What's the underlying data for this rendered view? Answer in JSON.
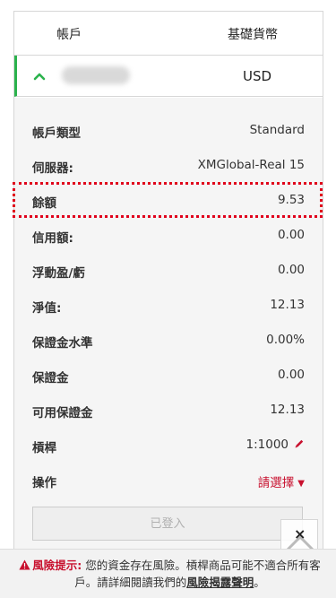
{
  "header": {
    "account_col": "帳戶",
    "currency_col": "基礎貨幣"
  },
  "account": {
    "currency": "USD"
  },
  "details": [
    {
      "label": "帳戶類型",
      "value": "Standard"
    },
    {
      "label": "伺服器:",
      "value": "XMGlobal-Real 15"
    },
    {
      "label": "餘額",
      "value": "9.53"
    },
    {
      "label": "信用額:",
      "value": "0.00"
    },
    {
      "label": "浮動盈/虧",
      "value": "0.00"
    },
    {
      "label": "淨值:",
      "value": "12.13"
    },
    {
      "label": "保證金水準",
      "value": "0.00%"
    },
    {
      "label": "保證金",
      "value": "0.00"
    },
    {
      "label": "可用保證金",
      "value": "12.13"
    },
    {
      "label": "槓桿",
      "value": "1:1000"
    },
    {
      "label": "操作",
      "value": "請選擇"
    }
  ],
  "login_button": "已登入",
  "close_label": "×",
  "risk": {
    "label": "風險提示:",
    "text1": "您的資金存在風險。槓桿商品可能不適合所有客戶。請詳細閱讀我們的",
    "link": "風險揭露聲明",
    "end": "。"
  },
  "colors": {
    "accent_green": "#2bb24c",
    "accent_red": "#c8102e",
    "highlight_dotted": "#e0001b"
  },
  "icons": {
    "expand": "chevron-up-icon",
    "edit": "pencil-icon",
    "dropdown": "caret-down-icon",
    "warning": "warning-icon",
    "close": "close-icon",
    "scroll_top": "arrow-up-icon"
  }
}
